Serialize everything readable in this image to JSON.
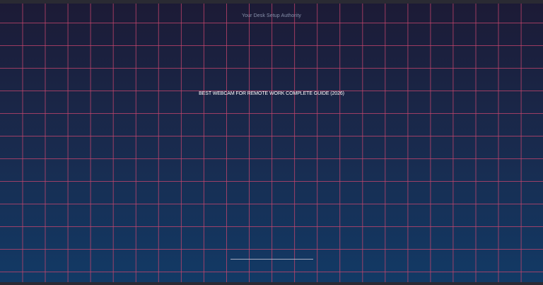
{
  "header": {
    "tagline": "Your Desk Setup Authority"
  },
  "hero": {
    "title": "BEST WEBCAM FOR REMOTE WORK COMPLETE GUIDE (2026)"
  },
  "loader": {
    "progress": 1.0
  },
  "colors": {
    "grid_line": "#c8466e",
    "background_top": "#1c1a35",
    "background_bottom": "#123a66"
  }
}
